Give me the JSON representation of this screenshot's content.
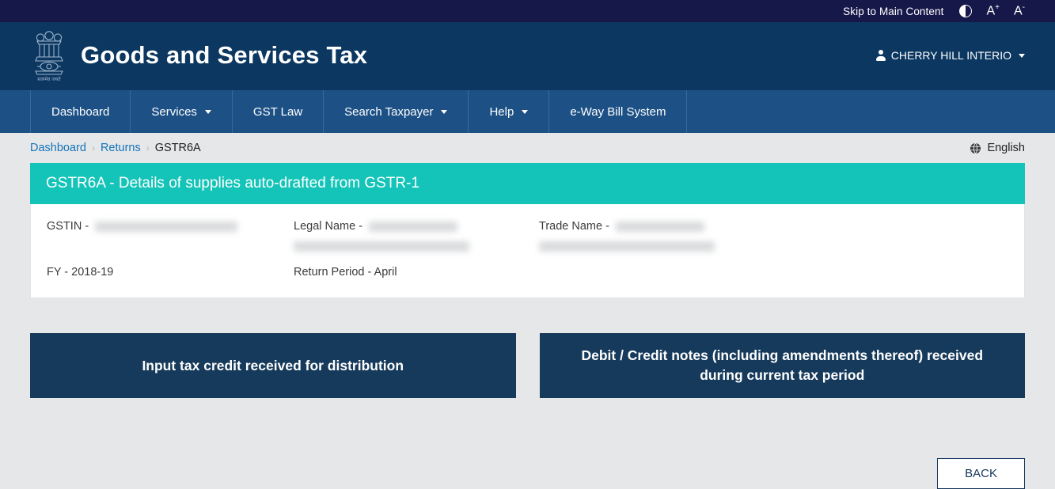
{
  "utility_bar": {
    "skip_link": "Skip to Main Content",
    "contrast_toggle": "contrast-icon",
    "font_increase": "A",
    "font_increase_sup": "+",
    "font_decrease": "A",
    "font_decrease_sup": "-"
  },
  "header": {
    "emblem": "india-national-emblem",
    "title": "Goods and Services Tax",
    "user": {
      "name": "CHERRY HILL INTERIO",
      "icon": "user-icon",
      "caret": "chevron-down-icon"
    }
  },
  "nav": {
    "items": [
      {
        "label": "Dashboard",
        "has_caret": false
      },
      {
        "label": "Services",
        "has_caret": true
      },
      {
        "label": "GST Law",
        "has_caret": false
      },
      {
        "label": "Search Taxpayer",
        "has_caret": true
      },
      {
        "label": "Help",
        "has_caret": true
      },
      {
        "label": "e-Way Bill System",
        "has_caret": false
      }
    ]
  },
  "breadcrumb": {
    "items": [
      {
        "label": "Dashboard",
        "current": false
      },
      {
        "label": "Returns",
        "current": false
      },
      {
        "label": "GSTR6A",
        "current": true
      }
    ],
    "separator": "›"
  },
  "language": {
    "icon": "globe-icon",
    "label": "English"
  },
  "panel": {
    "title": "GSTR6A - Details of supplies auto-drafted from GSTR-1",
    "accent_color": "#14c4b8",
    "details": {
      "gstin_label": "GSTIN -",
      "gstin_value": "",
      "legal_name_label": "Legal Name -",
      "legal_name_value": "",
      "trade_name_label": "Trade Name -",
      "trade_name_value": "",
      "fy_label": "FY - 2018-19",
      "return_period_label": "Return Period - April"
    }
  },
  "tiles": [
    {
      "label": "Input tax credit received for distribution"
    },
    {
      "label": "Debit / Credit notes (including amendments thereof) received during current tax period"
    }
  ],
  "actions": {
    "back_label": "BACK"
  },
  "colors": {
    "utility_bar": "#16184a",
    "header": "#0b3761",
    "nav": "#1d5186",
    "page_background": "#e5e7e9",
    "teal_accent": "#14c4b8",
    "tile": "#163a5b",
    "link": "#1574b8"
  }
}
